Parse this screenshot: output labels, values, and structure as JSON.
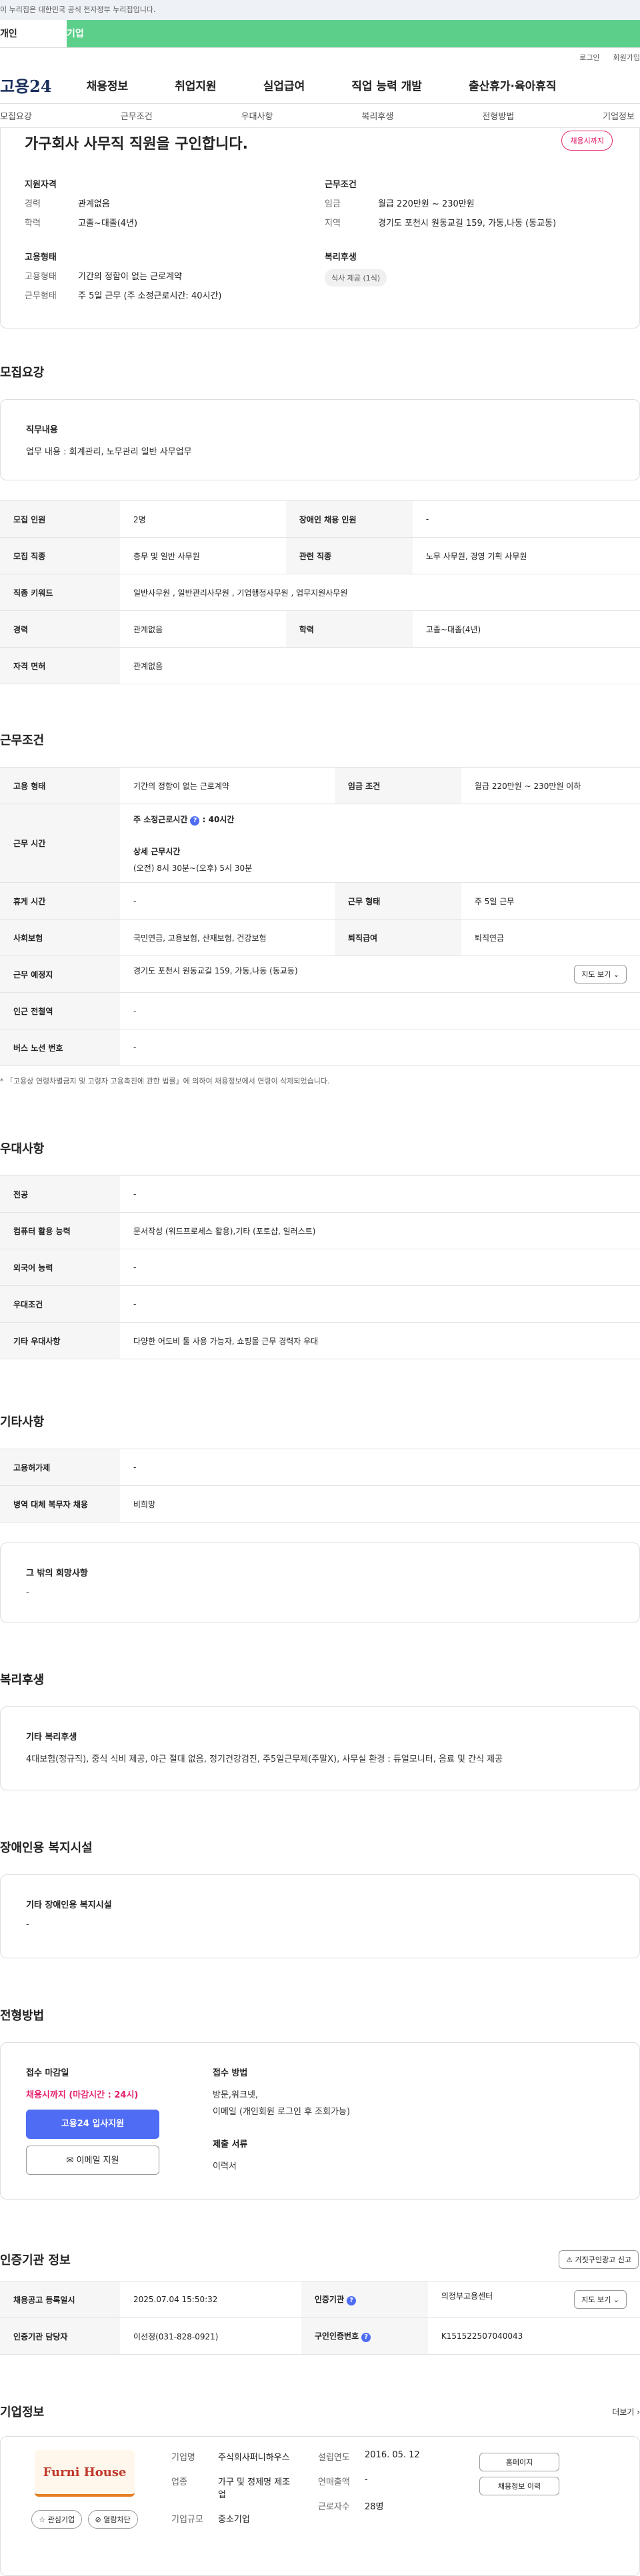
{
  "gov_banner": "이 누리집은 대한민국 공식 전자정부 누리집입니다.",
  "user_tabs": [
    "개인",
    "기업"
  ],
  "util": [
    "로그인",
    "회원가입"
  ],
  "logo": "고용24",
  "gnb": [
    "채용정보",
    "취업지원",
    "실업급여",
    "직업 능력 개발",
    "출산휴가·육아휴직"
  ],
  "subnav": [
    "모집요강",
    "근무조건",
    "우대사항",
    "복리후생",
    "전형방법",
    "기업정보"
  ],
  "job_title": "가구회사 사무직 직원을 구인합니다.",
  "close_badge": "채용시까지",
  "summary": {
    "qual_h": "지원자격",
    "exp_k": "경력",
    "exp_v": "관계없음",
    "edu_k": "학력",
    "edu_v": "고졸~대졸(4년)",
    "cond_h": "근무조건",
    "wage_k": "임금",
    "wage_v": "월급 220만원 ~ 230만원",
    "area_k": "지역",
    "area_v": "경기도 포천시 원동교길 159, 가동,나동 (동교동)",
    "emp_h": "고용형태",
    "type_k": "고용형태",
    "type_v": "기간의 정함이 없는 근로계약",
    "form_k": "근무형태",
    "form_v": "주 5일 근무 (주 소정근로시간: 40시간)",
    "welf_h": "복리후생",
    "welf_chip": "식사 제공 (1식)"
  },
  "recruit": {
    "title": "모집요강",
    "duty_h": "직무내용",
    "duty_v": "업무 내용 : 회계관리, 노무관리 일반 사무업무",
    "rows": [
      [
        "모집 인원",
        "2명",
        "장애인 채용 인원",
        "-"
      ],
      [
        "모집 직종",
        "총무 및 일반 사무원",
        "관련 직종",
        "노무 사무원, 경영 기획 사무원"
      ]
    ],
    "kw_k": "직종 키워드",
    "kw_v": "일반사무원 , 일반관리사무원 , 기업행정사무원 , 업무지원사무원",
    "exp_row": [
      "경력",
      "관계없음",
      "학력",
      "고졸~대졸(4년)"
    ],
    "lic_k": "자격 면허",
    "lic_v": "관계없음"
  },
  "cond": {
    "title": "근무조건",
    "emp_k": "고용 형태",
    "emp_v": "기간의 정함이 없는 근로계약",
    "wage_k": "임금 조건",
    "wage_v": "월급 220만원 ~ 230만원 이하",
    "time_k": "근무 시간",
    "time_l1": "주 소정근로시간",
    "time_l1v": ": 40시간",
    "time_l2": "상세 근무시간",
    "time_l3": "(오전) 8시 30분~(오후) 5시 30분",
    "rest_k": "휴게 시간",
    "rest_v": "-",
    "form_k": "근무 형태",
    "form_v": "주 5일 근무",
    "ins_k": "사회보험",
    "ins_v": "국민연금, 고용보험, 산재보험, 건강보험",
    "ret_k": "퇴직급여",
    "ret_v": "퇴직연금",
    "loc_k": "근무 예정지",
    "loc_v": "경기도 포천시 원동교길 159, 가동,나동 (동교동)",
    "map_btn": "지도 보기 ⌄",
    "sub_k": "인근 전철역",
    "sub_v": "-",
    "bus_k": "버스 노선 번호",
    "bus_v": "-",
    "note": "* 「고용상 연령차별금지 및 고령자 고용촉진에 관한 법률」에 의하여 채용정보에서 연령이 삭제되었습니다."
  },
  "pref": {
    "title": "우대사항",
    "rows": [
      [
        "전공",
        "-"
      ],
      [
        "컴퓨터 활용 능력",
        "문서작성 (워드프로세스 활용),기타 (포토샵, 일러스트)"
      ],
      [
        "외국어 능력",
        "-"
      ],
      [
        "우대조건",
        "-"
      ],
      [
        "기타 우대사항",
        "다양한 어도비 툴 사용 가능자, 쇼핑몰 근무 경력자 우대"
      ]
    ]
  },
  "etc": {
    "title": "기타사항",
    "rows": [
      [
        "고용허가제",
        "-"
      ],
      [
        "병역 대체 복무자 채용",
        "비희망"
      ]
    ],
    "h": "그 밖의 희망사항",
    "v": "-"
  },
  "welf": {
    "title": "복리후생",
    "h": "기타 복리후생",
    "v": "4대보험(정규직), 중식 식비 제공, 야근 절대 없음, 정기건강검진, 주5일근무제(주말X), 사무실 환경 : 듀얼모니터, 음료 및 간식 제공"
  },
  "dis": {
    "title": "장애인용 복지시설",
    "h": "기타 장애인용 복지시설",
    "v": "-"
  },
  "proc": {
    "title": "전형방법",
    "dl_h": "접수 마감일",
    "dl_v": "채용시까지 (마감시간 : 24시)",
    "btn1": "고용24 입사지원",
    "btn2": "✉ 이메일 지원",
    "m_h": "접수 방법",
    "m_v1": "방문,워크넷,",
    "m_v2": "이메일 (개인회원 로그인 후 조회가능)",
    "doc_h": "제출 서류",
    "doc_v": "이력서"
  },
  "cert": {
    "title": "인증기관 정보",
    "report": "⚠ 거짓구인광고 신고",
    "r1": [
      "채용공고 등록일시",
      "2025.07.04 15:50:32",
      "인증기관",
      "의정부고용센터",
      "지도 보기 ⌄"
    ],
    "r2": [
      "인증기관 담당자",
      "이선정(031-828-0921)",
      "구인인증번호",
      "K151522507040043"
    ]
  },
  "corp": {
    "title": "기업정보",
    "more": "더보기 ›",
    "logo_text": "Furni House",
    "fav": "☆ 관심기업",
    "block": "⊘ 열람차단",
    "name_k": "기업명",
    "name_v": "주식회사퍼니하우스",
    "ind_k": "업종",
    "ind_v": "가구 및 정제명 제조업",
    "size_k": "기업규모",
    "size_v": "중소기업",
    "est_k": "설립연도",
    "est_v": "2016. 05. 12",
    "rev_k": "연매출액",
    "rev_v": "-",
    "emp_k": "근로자수",
    "emp_v": "28명",
    "home_btn": "홈페이지",
    "jobs_btn": "채용정보 이력"
  }
}
